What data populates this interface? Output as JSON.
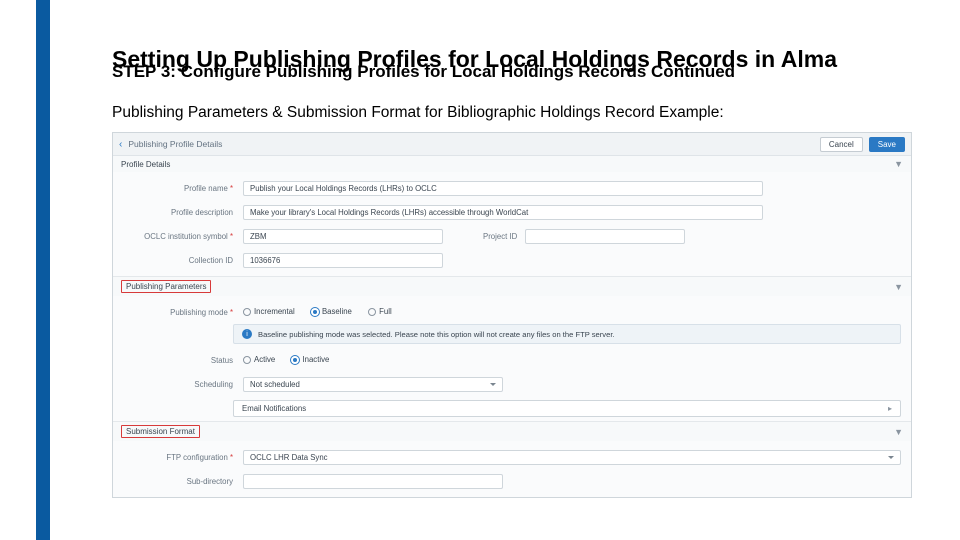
{
  "slide": {
    "title": "Setting Up Publishing Profiles for Local Holdings Records in Alma",
    "step": "STEP 3: Configure Publishing Profiles for Local Holdings Records Continued",
    "subdesc": "Publishing Parameters & Submission Format for Bibliographic Holdings Record Example:"
  },
  "topbar": {
    "breadcrumb": "Publishing Profile Details",
    "cancel": "Cancel",
    "save": "Save"
  },
  "profile_details": {
    "heading": "Profile Details",
    "labels": {
      "name": "Profile name",
      "desc": "Profile description",
      "symbol": "OCLC institution symbol",
      "project": "Project ID",
      "collid": "Collection ID"
    },
    "values": {
      "name": "Publish your Local Holdings Records (LHRs) to OCLC",
      "desc": "Make your library's Local Holdings Records (LHRs) accessible through WorldCat",
      "symbol": "ZBM",
      "project": "",
      "collid": "1036676"
    }
  },
  "publishing_params": {
    "heading": "Publishing Parameters",
    "labels": {
      "mode": "Publishing mode",
      "status": "Status",
      "scheduling": "Scheduling"
    },
    "mode_options": {
      "incremental": "Incremental",
      "baseline": "Baseline",
      "full": "Full"
    },
    "info": "Baseline publishing mode was selected. Please note this option will not create any files on the FTP server.",
    "status_options": {
      "active": "Active",
      "inactive": "Inactive"
    },
    "scheduling_value": "Not scheduled",
    "email_notifications": "Email Notifications"
  },
  "submission_format": {
    "heading": "Submission Format",
    "labels": {
      "ftp": "FTP configuration",
      "subdir": "Sub-directory"
    },
    "ftp_value": "OCLC LHR Data Sync",
    "subdir_value": ""
  }
}
